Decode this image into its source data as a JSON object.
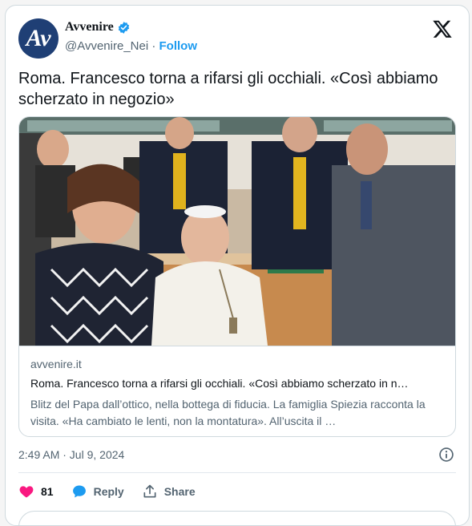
{
  "account": {
    "name": "Avvenire",
    "handle": "@Avvenire_Nei",
    "separator": " · ",
    "follow_label": "Follow",
    "avatar_text": "Av"
  },
  "tweet": {
    "text": "Roma. Francesco torna a rifarsi gli occhiali. «Così abbiamo scherzato in negozio»"
  },
  "link_card": {
    "domain": "avvenire.it",
    "title": "Roma. Francesco torna a rifarsi gli occhiali. «Così abbiamo scherzato in n…",
    "description": "Blitz del Papa dall’ottico, nella bottega di fiducia. La famiglia Spiezia racconta la visita. «Ha cambiato le lenti, non la montatura». All’uscita il …"
  },
  "meta": {
    "timestamp": "2:49 AM · Jul 9, 2024"
  },
  "actions": {
    "like_count": "81",
    "reply_label": "Reply",
    "share_label": "Share"
  },
  "colors": {
    "accent": "#1d9bf0",
    "like": "#f91880",
    "avatar_bg": "#1f3f75"
  },
  "icons": [
    "verified-badge-icon",
    "x-logo-icon",
    "info-icon",
    "heart-icon",
    "reply-bubble-icon",
    "share-icon"
  ]
}
